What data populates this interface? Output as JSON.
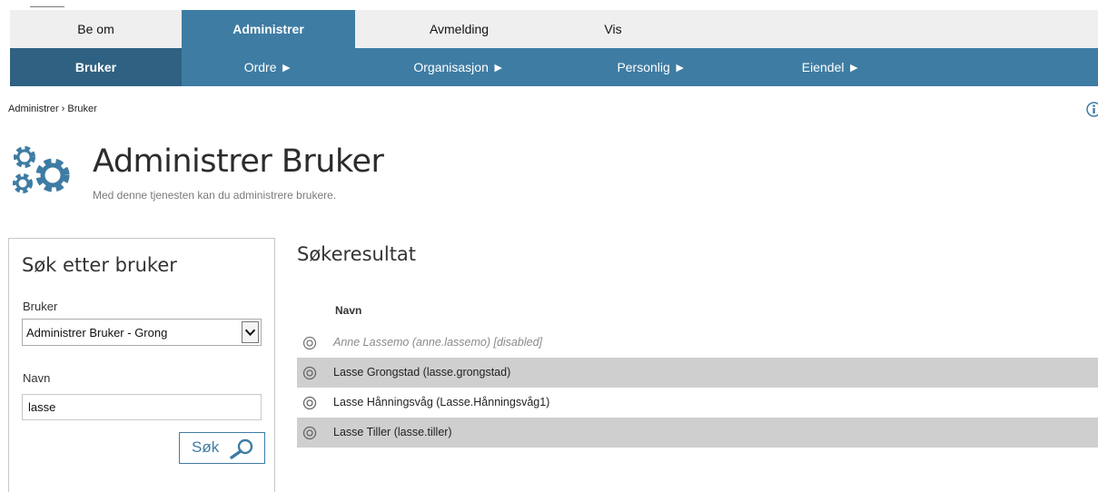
{
  "nav_primary": [
    "Be om",
    "Administrer",
    "Avmelding",
    "Vis"
  ],
  "nav_secondary": [
    "Bruker",
    "Ordre ►",
    "Organisasjon ►",
    "Personlig ►",
    "Eiendel ►"
  ],
  "breadcrumb": "Administrer › Bruker",
  "page": {
    "title": "Administrer Bruker",
    "subtitle": "Med denne tjenesten kan du administrere brukere."
  },
  "search": {
    "title": "Søk etter bruker",
    "bruker_label": "Bruker",
    "bruker_value": "Administrer Bruker - Grong",
    "navn_label": "Navn",
    "navn_value": "lasse",
    "button_label": "Søk"
  },
  "results": {
    "title": "Søkeresultat",
    "column_header": "Navn",
    "rows": [
      "Anne Lassemo (anne.lassemo) [disabled]",
      "Lasse Grongstad (lasse.grongstad)",
      "Lasse Hånningsvåg (Lasse.Hånningsvåg1)",
      "Lasse Tiller (lasse.tiller)"
    ]
  },
  "colors": {
    "accent": "#3e7ca3",
    "accent_dark": "#2f6182",
    "nav_bg": "#efefef",
    "row_alt": "#d0cfcf"
  },
  "icons": [
    "gears-icon",
    "info-icon",
    "search-magnifier-icon",
    "radio-icon",
    "chevron-down-icon"
  ]
}
